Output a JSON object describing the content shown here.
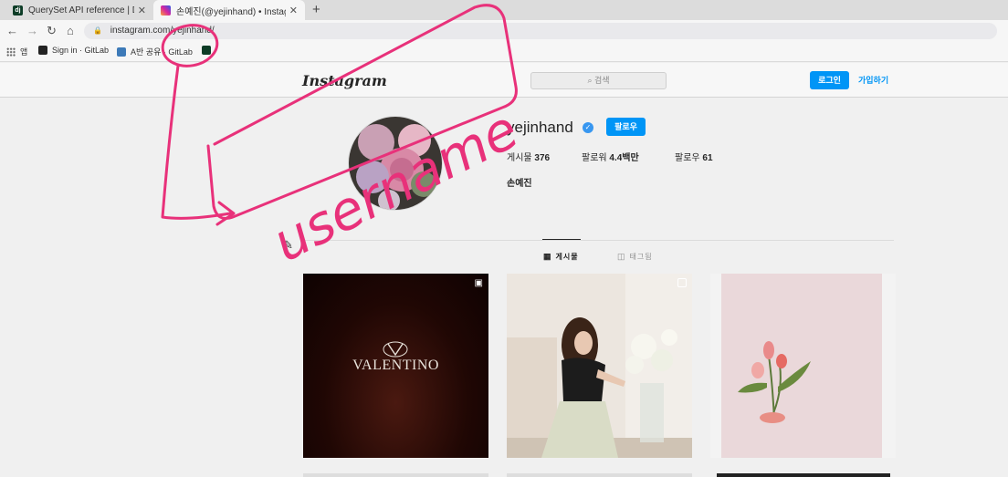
{
  "browser": {
    "tabs": [
      {
        "title": "QuerySet API reference | Django",
        "favicon_text": "dj",
        "favicon_color": "#0c3c26"
      },
      {
        "title": "손예진(@yejinhand) • Instagram",
        "favicon_color": "#d6249f"
      }
    ],
    "new_tab_symbol": "+",
    "url": "instagram.com/yejinhand/",
    "bookmarks": [
      {
        "label": "앱",
        "icon": "apps-grid-icon"
      },
      {
        "label": "Sign in · GitLab",
        "icon": "bookmark-icon",
        "color": "#222222"
      },
      {
        "label": "A반 공유 · GitLab",
        "icon": "bookmark-icon",
        "color": "#3d7ab8"
      },
      {
        "label": "",
        "icon": "django-icon",
        "color": "#0c3c26"
      }
    ]
  },
  "instagram": {
    "logo": "Instagram",
    "search_placeholder": "검색",
    "login_label": "로그인",
    "signup_label": "가입하기",
    "profile": {
      "username": "yejinhand",
      "verified": true,
      "follow_label": "팔로우",
      "posts_label": "게시물",
      "posts_count": "376",
      "followers_label": "팔로워",
      "followers_count": "4.4백만",
      "following_label": "팔로우",
      "following_count": "61",
      "full_name": "손예진"
    },
    "tabs": [
      {
        "label": "게시물",
        "icon": "grid-icon",
        "active": true
      },
      {
        "label": "태그됨",
        "icon": "tag-icon",
        "active": false
      }
    ],
    "posts": [
      {
        "text": "VALENTINO",
        "type": "reel",
        "color": "#1a0504"
      },
      {
        "type": "carousel",
        "color": "#ece6df"
      },
      {
        "type": "image",
        "color": "#e8d6d8"
      }
    ]
  },
  "annotation": {
    "handwritten_text": "username",
    "color": "#e8317a"
  }
}
